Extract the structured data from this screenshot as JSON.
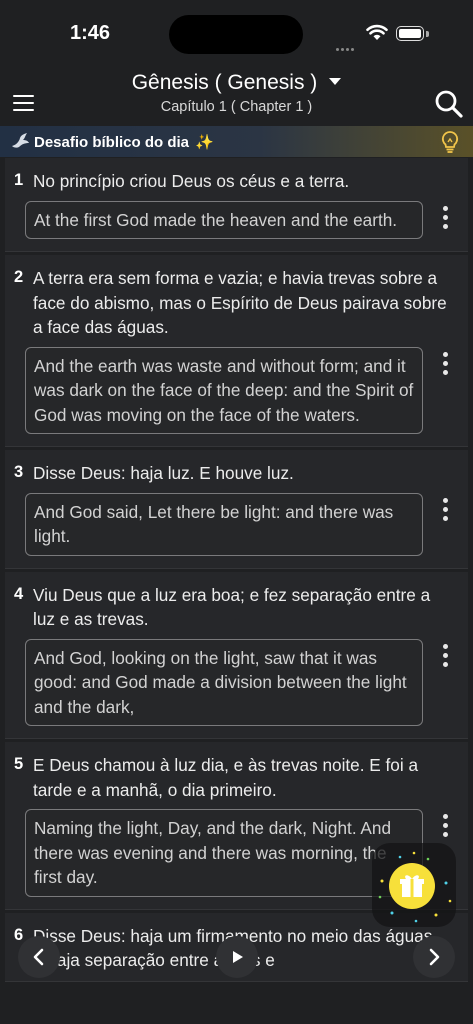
{
  "status_bar": {
    "time": "1:46"
  },
  "header": {
    "book_title": "Gênesis ( Genesis )",
    "chapter_subtitle": "Capítulo 1 ( Chapter 1 )",
    "menu_icon": "hamburger-menu-icon",
    "search_icon": "search-icon"
  },
  "banner": {
    "text": "Desafio bíblico do dia",
    "sparkle": "✨",
    "dove_icon": "dove-icon",
    "hint_icon": "lightbulb-icon"
  },
  "verses": [
    {
      "number": "1",
      "text": "No princípio criou Deus os céus e a terra.",
      "translation": "At the first God made the heaven and the earth."
    },
    {
      "number": "2",
      "text": "A terra era sem forma e vazia; e havia trevas sobre a face do abismo, mas o Espírito de Deus pairava sobre a face das águas.",
      "translation": "And the earth was waste and without form; and it was dark on the face of the deep: and the Spirit of God was moving on the face of the waters."
    },
    {
      "number": "3",
      "text": "Disse Deus: haja luz. E houve luz.",
      "translation": "And God said, Let there be light: and there was light."
    },
    {
      "number": "4",
      "text": "Viu Deus que a luz era boa; e fez separação entre a luz e as trevas.",
      "translation": "And God, looking on the light, saw that it was good: and God made a division between the light and the dark,"
    },
    {
      "number": "5",
      "text": "E Deus chamou à luz dia, e às trevas noite. E foi a tarde e a manhã, o dia primeiro.",
      "translation": "Naming the light, Day, and the dark, Night. And there was evening and there was morning, the first day."
    },
    {
      "number": "6",
      "text": "Disse Deus: haja um firmamento no meio das águas, e haja separação entre águas e"
    }
  ],
  "controls": {
    "prev_icon": "chevron-left-icon",
    "play_icon": "play-icon",
    "next_icon": "chevron-right-icon",
    "gift_icon": "gift-icon"
  },
  "colors": {
    "background": "#1f2022",
    "accent_yellow": "#f7e03a",
    "banner_gold": "#f2c54a"
  }
}
